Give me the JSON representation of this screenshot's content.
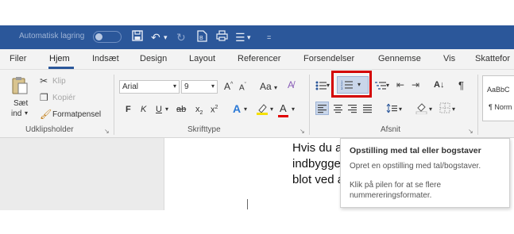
{
  "titlebar": {
    "autosave_label": "Automatisk lagring",
    "qat_icons": [
      "save-icon",
      "undo-icon",
      "redo-icon",
      "file-icon",
      "print-icon",
      "bullets-icon",
      "customize-icon"
    ]
  },
  "tabs": [
    "Filer",
    "Hjem",
    "Indsæt",
    "Design",
    "Layout",
    "Referencer",
    "Forsendelser",
    "Gennemse",
    "Vis",
    "Skattefor"
  ],
  "active_tab": "Hjem",
  "clipboard": {
    "paste_line1": "Sæt",
    "paste_line2": "ind",
    "cut": "Klip",
    "copy": "Kopiér",
    "format_painter": "Formatpensel",
    "group_label": "Udklipsholder"
  },
  "font": {
    "font_name": "Arial",
    "font_size": "9",
    "grow": "A",
    "shrink": "A",
    "change_case": "Aa",
    "bold": "F",
    "italic": "K",
    "underline": "U",
    "strike": "ab",
    "subscript": "x",
    "superscript": "x",
    "text_effects": "A",
    "font_color": "A",
    "group_label": "Skrifttype"
  },
  "paragraph": {
    "group_label": "Afsnit",
    "sort_icon": "A↓",
    "pilcrow": "¶"
  },
  "styles": {
    "preview": "AaBbC",
    "normal": "¶ Norm"
  },
  "document": {
    "line1": "Hvis du a",
    "line2": "indbygge",
    "line3": "blot ved a"
  },
  "tooltip": {
    "title": "Opstilling med tal eller bogstaver",
    "line1": "Opret en opstilling med tal/bogstaver.",
    "line2": "Klik på pilen for at se flere",
    "line3": "nummereringsformater."
  },
  "colors": {
    "title_bar": "#2b579a",
    "highlight": "#d40000",
    "ribbon_bg": "#f3f3f3",
    "font_color_bar": "#e00000",
    "highlight_color_bar": "#f5e000"
  }
}
